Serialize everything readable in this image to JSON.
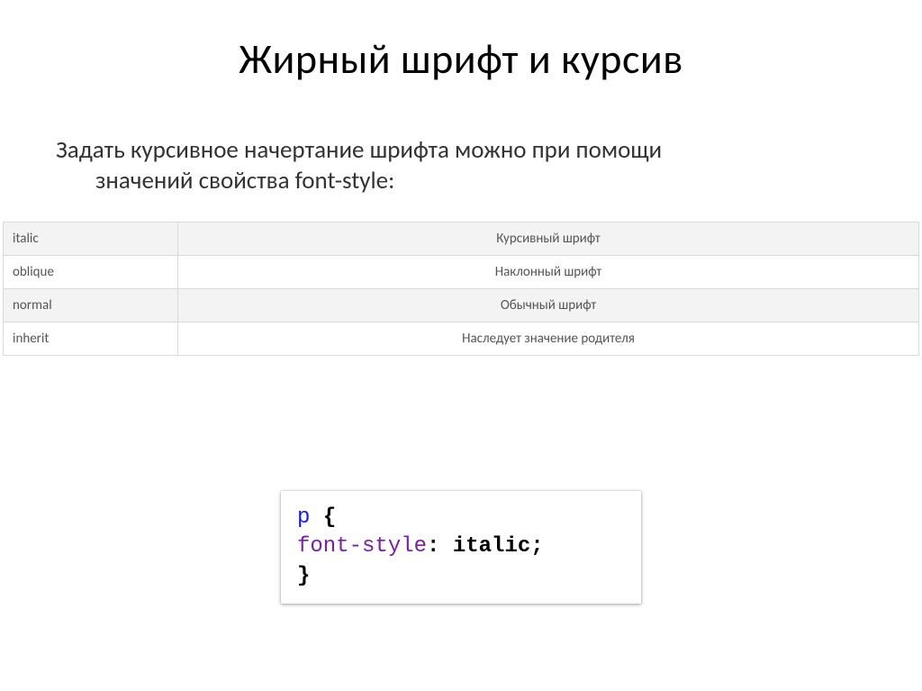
{
  "title": "Жирный шрифт и курсив",
  "body": {
    "line1": "Задать курсивное начертание шрифта можно при помощи",
    "line2": "значений свойства font-style:"
  },
  "table": {
    "rows": [
      {
        "key": "italic",
        "desc": "Курсивный шрифт"
      },
      {
        "key": "oblique",
        "desc": "Наклонный шрифт"
      },
      {
        "key": "normal",
        "desc": "Обычный шрифт"
      },
      {
        "key": "inherit",
        "desc": "Наследует значение родителя"
      }
    ]
  },
  "code": {
    "selector": "p",
    "open": "{",
    "prop": "font-style",
    "colon": ":",
    "value": "italic",
    "semi": ";",
    "close": "}"
  }
}
